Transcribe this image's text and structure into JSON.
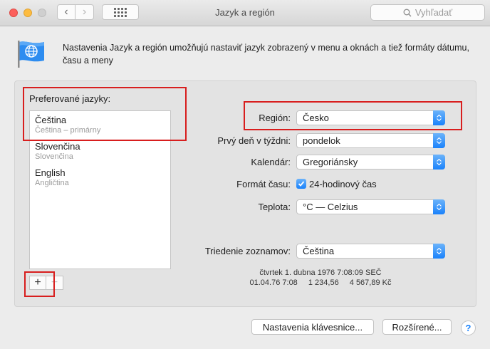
{
  "window": {
    "title": "Jazyk a región"
  },
  "search": {
    "placeholder": "Vyhľadať"
  },
  "description": "Nastavenia Jazyk a región umožňujú nastaviť jazyk zobrazený v menu a oknách a tiež formáty dátumu, času a meny",
  "preferred": {
    "label": "Preferované jazyky:",
    "languages": [
      {
        "name": "Čeština",
        "sub": "Čeština – primárny"
      },
      {
        "name": "Slovenčina",
        "sub": "Slovenčina"
      },
      {
        "name": "English",
        "sub": "Angličtina"
      }
    ],
    "add_label": "+",
    "remove_label": "−"
  },
  "settings": {
    "region_label": "Región:",
    "region_value": "Česko",
    "first_day_label": "Prvý deň v týždni:",
    "first_day_value": "pondelok",
    "calendar_label": "Kalendár:",
    "calendar_value": "Gregoriánsky",
    "time_format_label": "Formát času:",
    "time_format_value": "24-hodinový čas",
    "time_format_checked": true,
    "temperature_label": "Teplota:",
    "temperature_value": "°C — Celzius",
    "sort_label": "Triedenie zoznamov:",
    "sort_value": "Čeština"
  },
  "sample": {
    "date_long": "čtvrtek 1. dubna 1976 7:08:09 SEČ",
    "date_short": "01.04.76 7:08",
    "number": "1 234,56",
    "currency": "4 567,89 Kč"
  },
  "buttons": {
    "keyboard": "Nastavenia klávesnice...",
    "advanced": "Rozšírené...",
    "help": "?"
  },
  "colors": {
    "accent": "#1a82fb",
    "highlight_box": "#d81e1e"
  }
}
